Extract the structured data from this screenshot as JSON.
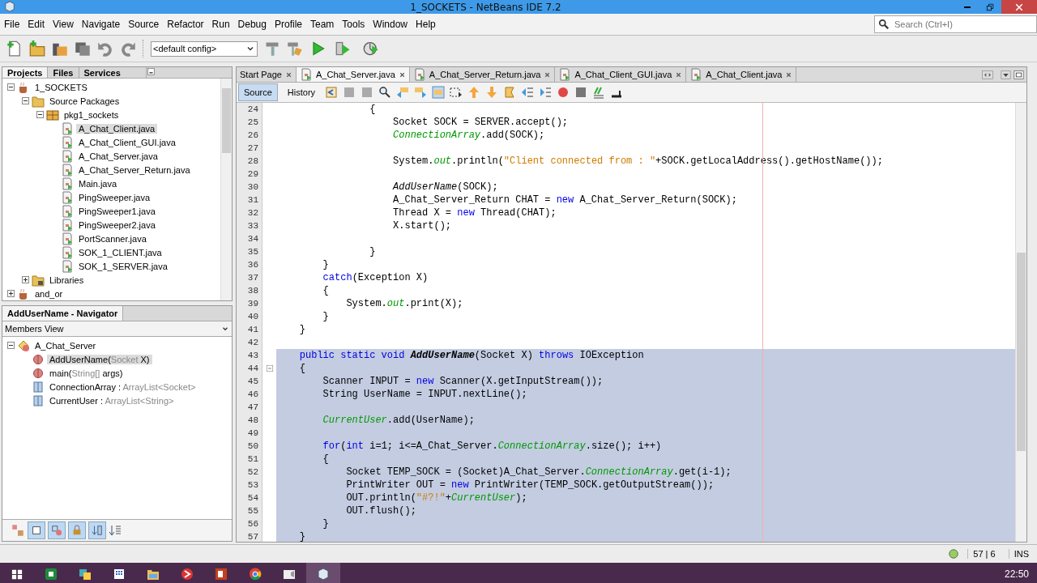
{
  "window": {
    "title": "1_SOCKETS - NetBeans IDE 7.2"
  },
  "menu": [
    "File",
    "Edit",
    "View",
    "Navigate",
    "Source",
    "Refactor",
    "Run",
    "Debug",
    "Profile",
    "Team",
    "Tools",
    "Window",
    "Help"
  ],
  "search": {
    "placeholder": "Search (Ctrl+I)"
  },
  "toolbar": {
    "config": "<default config>"
  },
  "projects_panel": {
    "tabs": [
      {
        "label": "Projects",
        "selected": true
      },
      {
        "label": "Files",
        "selected": false
      },
      {
        "label": "Services",
        "selected": false
      }
    ],
    "tree": [
      {
        "label": "1_SOCKETS",
        "kind": "project",
        "expanded": true,
        "selected": false,
        "children": [
          {
            "label": "Source Packages",
            "kind": "folder",
            "expanded": true,
            "selected": false,
            "children": [
              {
                "label": "pkg1_sockets",
                "kind": "package",
                "expanded": true,
                "selected": false,
                "children": [
                  {
                    "label": "A_Chat_Client.java",
                    "kind": "file",
                    "selected": true
                  },
                  {
                    "label": "A_Chat_Client_GUI.java",
                    "kind": "file",
                    "selected": false
                  },
                  {
                    "label": "A_Chat_Server.java",
                    "kind": "file",
                    "selected": false
                  },
                  {
                    "label": "A_Chat_Server_Return.java",
                    "kind": "file",
                    "selected": false
                  },
                  {
                    "label": "Main.java",
                    "kind": "file",
                    "selected": false
                  },
                  {
                    "label": "PingSweeper.java",
                    "kind": "file",
                    "selected": false
                  },
                  {
                    "label": "PingSweeper1.java",
                    "kind": "file",
                    "selected": false
                  },
                  {
                    "label": "PingSweeper2.java",
                    "kind": "file",
                    "selected": false
                  },
                  {
                    "label": "PortScanner.java",
                    "kind": "file",
                    "selected": false
                  },
                  {
                    "label": "SOK_1_CLIENT.java",
                    "kind": "file",
                    "selected": false
                  },
                  {
                    "label": "SOK_1_SERVER.java",
                    "kind": "file",
                    "selected": false
                  }
                ]
              }
            ]
          },
          {
            "label": "Libraries",
            "kind": "library",
            "expanded": false,
            "selected": false
          }
        ]
      },
      {
        "label": "and_or",
        "kind": "project",
        "expanded": false,
        "selected": false
      }
    ]
  },
  "navigator": {
    "title": "AddUserName - Navigator",
    "view": "Members View",
    "tree": [
      {
        "kind": "class",
        "expanded": true,
        "selected": false,
        "parts": [
          {
            "text": "A_Chat_Server",
            "muted": false
          }
        ],
        "children": [
          {
            "kind": "method",
            "selected": true,
            "parts": [
              {
                "text": "AddUserName(",
                "muted": false
              },
              {
                "text": "Socket",
                "muted": true
              },
              {
                "text": " X)",
                "muted": false
              }
            ]
          },
          {
            "kind": "method",
            "selected": false,
            "parts": [
              {
                "text": "main(",
                "muted": false
              },
              {
                "text": "String[]",
                "muted": true
              },
              {
                "text": " args)",
                "muted": false
              }
            ]
          },
          {
            "kind": "field",
            "selected": false,
            "parts": [
              {
                "text": "ConnectionArray : ",
                "muted": false
              },
              {
                "text": "ArrayList<Socket>",
                "muted": true
              }
            ]
          },
          {
            "kind": "field",
            "selected": false,
            "parts": [
              {
                "text": "CurrentUser : ",
                "muted": false
              },
              {
                "text": "ArrayList<String>",
                "muted": true
              }
            ]
          }
        ]
      }
    ]
  },
  "editor": {
    "tabs": [
      {
        "label": "Start Page",
        "selected": false
      },
      {
        "label": "A_Chat_Server.java",
        "selected": true
      },
      {
        "label": "A_Chat_Server_Return.java",
        "selected": false
      },
      {
        "label": "A_Chat_Client_GUI.java",
        "selected": false
      },
      {
        "label": "A_Chat_Client.java",
        "selected": false
      }
    ],
    "views": [
      {
        "label": "Source",
        "selected": true
      },
      {
        "label": "History",
        "selected": false
      }
    ],
    "lines": [
      {
        "number": "24",
        "selected": false,
        "tokens": [
          {
            "kind": "plain",
            "text": "                {"
          }
        ]
      },
      {
        "number": "25",
        "selected": false,
        "tokens": [
          {
            "kind": "plain",
            "text": "                    Socket SOCK = SERVER.accept();"
          }
        ]
      },
      {
        "number": "26",
        "selected": false,
        "tokens": [
          {
            "kind": "field",
            "text": "                    ConnectionArray"
          },
          {
            "kind": "plain",
            "text": ".add(SOCK);"
          }
        ]
      },
      {
        "number": "27",
        "selected": false
      },
      {
        "number": "28",
        "selected": false,
        "tokens": [
          {
            "kind": "plain",
            "text": "                    System."
          },
          {
            "kind": "field",
            "text": "out"
          },
          {
            "kind": "plain",
            "text": ".println("
          },
          {
            "kind": "string",
            "text": "\"Client connected from : \""
          },
          {
            "kind": "plain",
            "text": "+SOCK.getLocalAddress().getHostName());"
          }
        ]
      },
      {
        "number": "29",
        "selected": false
      },
      {
        "number": "30",
        "selected": false,
        "tokens": [
          {
            "kind": "call",
            "text": "                    AddUserName"
          },
          {
            "kind": "plain",
            "text": "(SOCK);"
          }
        ]
      },
      {
        "number": "31",
        "selected": false,
        "tokens": [
          {
            "kind": "plain",
            "text": "                    A_Chat_Server_Return CHAT = "
          },
          {
            "kind": "keyword",
            "text": "new"
          },
          {
            "kind": "plain",
            "text": " A_Chat_Server_Return(SOCK);"
          }
        ]
      },
      {
        "number": "32",
        "selected": false,
        "tokens": [
          {
            "kind": "plain",
            "text": "                    Thread X = "
          },
          {
            "kind": "keyword",
            "text": "new"
          },
          {
            "kind": "plain",
            "text": " Thread(CHAT);"
          }
        ]
      },
      {
        "number": "33",
        "selected": false,
        "tokens": [
          {
            "kind": "plain",
            "text": "                    X.start();"
          }
        ]
      },
      {
        "number": "34",
        "selected": false
      },
      {
        "number": "35",
        "selected": false,
        "tokens": [
          {
            "kind": "plain",
            "text": "                }"
          }
        ]
      },
      {
        "number": "36",
        "selected": false,
        "tokens": [
          {
            "kind": "plain",
            "text": "        }"
          }
        ]
      },
      {
        "number": "37",
        "selected": false,
        "tokens": [
          {
            "kind": "keyword",
            "text": "        catch"
          },
          {
            "kind": "plain",
            "text": "(Exception X)"
          }
        ]
      },
      {
        "number": "38",
        "selected": false,
        "tokens": [
          {
            "kind": "plain",
            "text": "        {"
          }
        ]
      },
      {
        "number": "39",
        "selected": false,
        "tokens": [
          {
            "kind": "plain",
            "text": "            System."
          },
          {
            "kind": "field",
            "text": "out"
          },
          {
            "kind": "plain",
            "text": ".print(X);"
          }
        ]
      },
      {
        "number": "40",
        "selected": false,
        "tokens": [
          {
            "kind": "plain",
            "text": "        }"
          }
        ]
      },
      {
        "number": "41",
        "selected": false,
        "tokens": [
          {
            "kind": "plain",
            "text": "    }"
          }
        ]
      },
      {
        "number": "42",
        "selected": false
      },
      {
        "number": "43",
        "selected": true,
        "tokens": [
          {
            "kind": "keyword",
            "text": "    public static void"
          },
          {
            "kind": "declaration",
            "text": " AddUserName"
          },
          {
            "kind": "plain",
            "text": "(Socket X) "
          },
          {
            "kind": "keyword",
            "text": "throws"
          },
          {
            "kind": "plain",
            "text": " IOException"
          }
        ]
      },
      {
        "number": "44",
        "selected": true,
        "tokens": [
          {
            "kind": "plain",
            "text": "    {"
          }
        ]
      },
      {
        "number": "45",
        "selected": true,
        "tokens": [
          {
            "kind": "plain",
            "text": "        Scanner INPUT = "
          },
          {
            "kind": "keyword",
            "text": "new"
          },
          {
            "kind": "plain",
            "text": " Scanner(X.getInputStream());"
          }
        ]
      },
      {
        "number": "46",
        "selected": true,
        "tokens": [
          {
            "kind": "plain",
            "text": "        String UserName = INPUT.nextLine();"
          }
        ]
      },
      {
        "number": "47",
        "selected": true
      },
      {
        "number": "48",
        "selected": true,
        "tokens": [
          {
            "kind": "field",
            "text": "        CurrentUser"
          },
          {
            "kind": "plain",
            "text": ".add(UserName);"
          }
        ]
      },
      {
        "number": "49",
        "selected": true
      },
      {
        "number": "50",
        "selected": true,
        "tokens": [
          {
            "kind": "keyword",
            "text": "        for"
          },
          {
            "kind": "plain",
            "text": "("
          },
          {
            "kind": "keyword",
            "text": "int"
          },
          {
            "kind": "plain",
            "text": " i=1; i<=A_Chat_Server."
          },
          {
            "kind": "field",
            "text": "ConnectionArray"
          },
          {
            "kind": "plain",
            "text": ".size(); i++)"
          }
        ]
      },
      {
        "number": "51",
        "selected": true,
        "tokens": [
          {
            "kind": "plain",
            "text": "        {"
          }
        ]
      },
      {
        "number": "52",
        "selected": true,
        "tokens": [
          {
            "kind": "plain",
            "text": "            Socket TEMP_SOCK = (Socket)A_Chat_Server."
          },
          {
            "kind": "field",
            "text": "ConnectionArray"
          },
          {
            "kind": "plain",
            "text": ".get(i-1);"
          }
        ]
      },
      {
        "number": "53",
        "selected": true,
        "tokens": [
          {
            "kind": "plain",
            "text": "            PrintWriter OUT = "
          },
          {
            "kind": "keyword",
            "text": "new"
          },
          {
            "kind": "plain",
            "text": " PrintWriter(TEMP_SOCK.getOutputStream());"
          }
        ]
      },
      {
        "number": "54",
        "selected": true,
        "tokens": [
          {
            "kind": "plain",
            "text": "            OUT.println("
          },
          {
            "kind": "string",
            "text": "\"#?!\""
          },
          {
            "kind": "plain",
            "text": "+"
          },
          {
            "kind": "field",
            "text": "CurrentUser"
          },
          {
            "kind": "plain",
            "text": ");"
          }
        ]
      },
      {
        "number": "55",
        "selected": true,
        "tokens": [
          {
            "kind": "plain",
            "text": "            OUT.flush();"
          }
        ]
      },
      {
        "number": "56",
        "selected": true,
        "tokens": [
          {
            "kind": "plain",
            "text": "        }"
          }
        ]
      },
      {
        "number": "57",
        "selected": true,
        "tokens": [
          {
            "kind": "plain",
            "text": "    }"
          }
        ]
      }
    ]
  },
  "status_bar": {
    "position": "57 | 6",
    "mode": "INS"
  },
  "taskbar": {
    "clock": "22:50"
  }
}
